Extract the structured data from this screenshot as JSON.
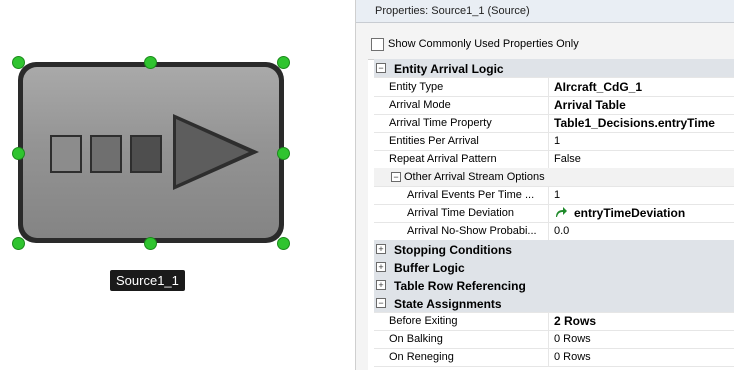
{
  "canvas": {
    "object_label": "Source1_1"
  },
  "panel": {
    "title": "Properties: Source1_1 (Source)",
    "common_only_label": "Show Commonly Used Properties Only",
    "sections": {
      "entity_arrival_logic": "Entity Arrival Logic",
      "stopping_conditions": "Stopping Conditions",
      "buffer_logic": "Buffer Logic",
      "table_row_referencing": "Table Row Referencing",
      "state_assignments": "State Assignments"
    },
    "subsection_other_arrival": "Other Arrival Stream Options",
    "props": [
      {
        "name": "Entity Type",
        "value": "AIrcraft_CdG_1"
      },
      {
        "name": "Arrival Mode",
        "value": "Arrival Table"
      },
      {
        "name": "Arrival Time Property",
        "value": "Table1_Decisions.entryTime"
      },
      {
        "name": "Entities Per Arrival",
        "value": "1"
      },
      {
        "name": "Repeat Arrival Pattern",
        "value": "False"
      }
    ],
    "sub_props": [
      {
        "name": "Arrival Events Per Time ...",
        "value": "1"
      },
      {
        "name": "Arrival Time Deviation",
        "value": "entryTimeDeviation"
      },
      {
        "name": "Arrival No-Show Probabi...",
        "value": "0.0"
      }
    ],
    "state_props": [
      {
        "name": "Before Exiting",
        "value": "2 Rows"
      },
      {
        "name": "On Balking",
        "value": "0 Rows"
      },
      {
        "name": "On Reneging",
        "value": "0 Rows"
      }
    ],
    "expand_collapsed": "+",
    "expand_expanded": "−",
    "accent_colors": {
      "handle": "#2fc42f",
      "category_bg": "#dfe3e8"
    }
  }
}
